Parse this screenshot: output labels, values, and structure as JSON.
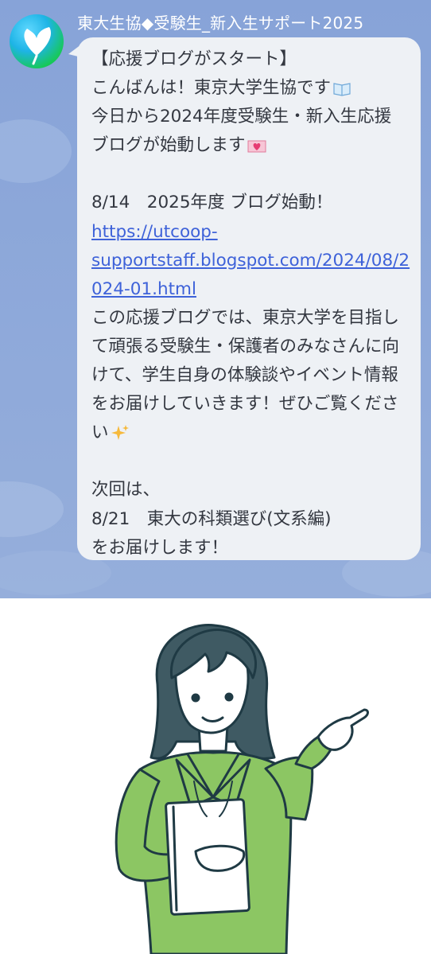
{
  "chat": {
    "sender_name": "東大生協◆受験生_新入生サポート2025",
    "avatar_icon": "ginkgo-leaf-icon",
    "message_lines": [
      "【応援ブログがスタート】",
      "こんばんは！東京大学生協です",
      "今日から2024年度受験生・新入生応援",
      "ブログが始動します",
      "",
      "8/14　2025年度 ブログ始動！",
      "この応援ブログでは、東京大学を目指して頑張る受験生・保護者のみなさんに向けて、学生自身の体験談やイベント情報をお届けしていきます！ぜひご覧ください",
      "",
      "次回は、",
      "8/21　東大の科類選び(文系編)",
      "をお届けします！"
    ],
    "link_lines": [
      "https://utcoop-",
      "supportstaff.blogspot.com/2024/08/2",
      "024-01.html"
    ],
    "emoji_icons": [
      "open-book-icon",
      "heart-letter-icon",
      "sparkles-icon"
    ]
  },
  "illustration": {
    "subject": "student-pointing-illustration",
    "jacket_color": "#8cc663",
    "outline_color": "#1f3a44",
    "hair_color": "#3f5a63"
  }
}
